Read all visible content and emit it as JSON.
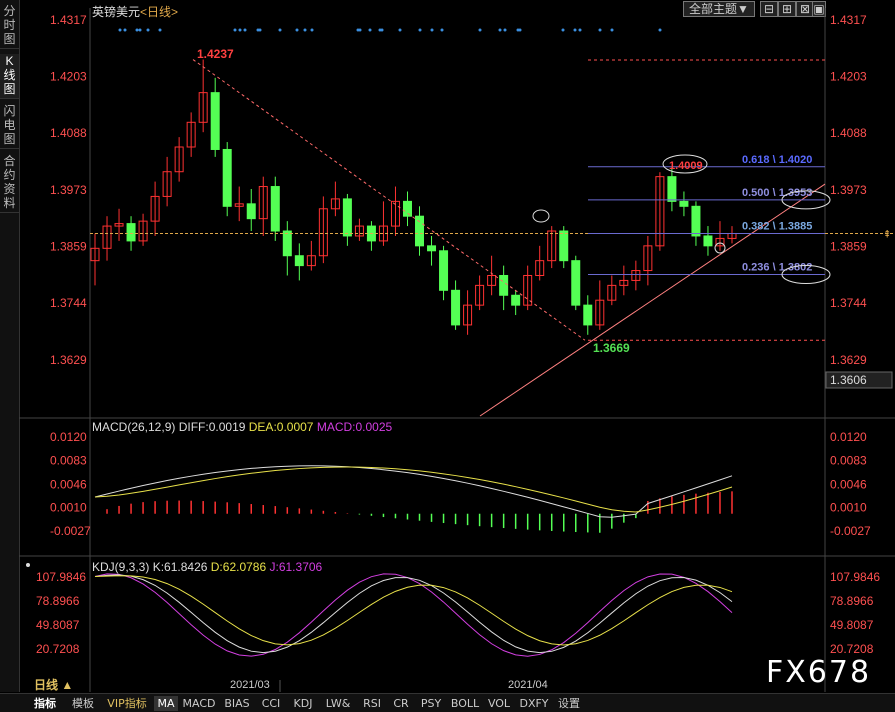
{
  "sidebar": {
    "tabs": [
      {
        "label": "分时图"
      },
      {
        "label": "K线图"
      },
      {
        "label": "闪电图"
      },
      {
        "label": "合约资料"
      }
    ]
  },
  "header": {
    "instrument": "英镑美元",
    "period": "<日线>",
    "theme_button": "全部主题▼"
  },
  "chart_data": {
    "type": "candlestick",
    "price_axis_ticks": [
      1.4317,
      1.4203,
      1.4088,
      1.3973,
      1.3859,
      1.3744,
      1.3629
    ],
    "current_price_label": "1.3606",
    "high_label": "1.4237",
    "low_label": "1.3669",
    "fib_levels": [
      {
        "ratio": "0.618",
        "value": "1.4020"
      },
      {
        "ratio": "0.500",
        "value": "1.3953"
      },
      {
        "ratio": "0.382",
        "value": "1.3885"
      },
      {
        "ratio": "0.236",
        "value": "1.3802"
      }
    ],
    "annotated_high": "1.4009",
    "candles": [
      [
        1.383,
        1.3855,
        1.3885,
        1.378
      ],
      [
        1.3855,
        1.39,
        1.392,
        1.383
      ],
      [
        1.39,
        1.3905,
        1.3935,
        1.387
      ],
      [
        1.3905,
        1.387,
        1.392,
        1.385
      ],
      [
        1.387,
        1.391,
        1.3925,
        1.386
      ],
      [
        1.391,
        1.396,
        1.399,
        1.388
      ],
      [
        1.396,
        1.401,
        1.404,
        1.394
      ],
      [
        1.401,
        1.406,
        1.408,
        1.399
      ],
      [
        1.406,
        1.411,
        1.413,
        1.404
      ],
      [
        1.411,
        1.417,
        1.4237,
        1.409
      ],
      [
        1.417,
        1.4055,
        1.42,
        1.404
      ],
      [
        1.4055,
        1.394,
        1.407,
        1.392
      ],
      [
        1.394,
        1.3945,
        1.398,
        1.391
      ],
      [
        1.3945,
        1.3915,
        1.3975,
        1.389
      ],
      [
        1.3915,
        1.398,
        1.4,
        1.388
      ],
      [
        1.398,
        1.389,
        1.4,
        1.387
      ],
      [
        1.389,
        1.384,
        1.391,
        1.38
      ],
      [
        1.384,
        1.382,
        1.3865,
        1.379
      ],
      [
        1.382,
        1.384,
        1.387,
        1.381
      ],
      [
        1.384,
        1.3935,
        1.396,
        1.3825
      ],
      [
        1.3935,
        1.3955,
        1.399,
        1.392
      ],
      [
        1.3955,
        1.388,
        1.3965,
        1.386
      ],
      [
        1.388,
        1.39,
        1.3915,
        1.387
      ],
      [
        1.39,
        1.387,
        1.391,
        1.385
      ],
      [
        1.387,
        1.39,
        1.395,
        1.386
      ],
      [
        1.39,
        1.395,
        1.398,
        1.388
      ],
      [
        1.395,
        1.392,
        1.397,
        1.39
      ],
      [
        1.392,
        1.386,
        1.394,
        1.384
      ],
      [
        1.386,
        1.385,
        1.388,
        1.382
      ],
      [
        1.385,
        1.377,
        1.386,
        1.375
      ],
      [
        1.377,
        1.37,
        1.379,
        1.369
      ],
      [
        1.37,
        1.374,
        1.377,
        1.368
      ],
      [
        1.374,
        1.378,
        1.38,
        1.373
      ],
      [
        1.378,
        1.38,
        1.384,
        1.376
      ],
      [
        1.38,
        1.376,
        1.382,
        1.373
      ],
      [
        1.376,
        1.374,
        1.377,
        1.372
      ],
      [
        1.374,
        1.38,
        1.382,
        1.373
      ],
      [
        1.38,
        1.383,
        1.386,
        1.379
      ],
      [
        1.383,
        1.389,
        1.39,
        1.3815
      ],
      [
        1.389,
        1.383,
        1.39,
        1.3815
      ],
      [
        1.383,
        1.374,
        1.384,
        1.373
      ],
      [
        1.374,
        1.37,
        1.376,
        1.368
      ],
      [
        1.37,
        1.375,
        1.379,
        1.369
      ],
      [
        1.375,
        1.378,
        1.38,
        1.374
      ],
      [
        1.378,
        1.379,
        1.382,
        1.376
      ],
      [
        1.379,
        1.381,
        1.383,
        1.377
      ],
      [
        1.381,
        1.386,
        1.388,
        1.378
      ],
      [
        1.386,
        1.4,
        1.4009,
        1.385
      ],
      [
        1.4,
        1.395,
        1.402,
        1.393
      ],
      [
        1.395,
        1.394,
        1.397,
        1.392
      ],
      [
        1.394,
        1.388,
        1.395,
        1.386
      ],
      [
        1.388,
        1.386,
        1.39,
        1.384
      ],
      [
        1.386,
        1.3875,
        1.391,
        1.385
      ],
      [
        1.3875,
        1.3885,
        1.39,
        1.3865
      ]
    ],
    "macd": {
      "label": "MACD(26,12,9)",
      "diff": "DIFF:0.0019",
      "dea": "DEA:0.0007",
      "macd": "MACD:0.0025",
      "ticks": [
        0.012,
        0.0083,
        0.0046,
        0.001,
        -0.0027
      ]
    },
    "kdj": {
      "label": "KDJ(9,3,3)",
      "k": "K:61.8426",
      "d": "D:62.0786",
      "j": "J:61.3706",
      "ticks": [
        107.9846,
        78.8966,
        49.8087,
        20.7208
      ]
    },
    "x_labels": [
      "2021/03",
      "2021/04"
    ]
  },
  "footer": {
    "period_label": "日线 ▲",
    "tabs": [
      "指标",
      "模板",
      "VIP指标",
      "MA",
      "MACD",
      "BIAS",
      "CCI",
      "KDJ",
      "LW&",
      "RSI",
      "CR",
      "PSY",
      "BOLL",
      "VOL",
      "DXFY",
      "设置"
    ],
    "watermark": "FX678"
  },
  "colors": {
    "up": "#ff3232",
    "down": "#54ff54",
    "bg": "#000000",
    "ma": "#e0a84a"
  }
}
